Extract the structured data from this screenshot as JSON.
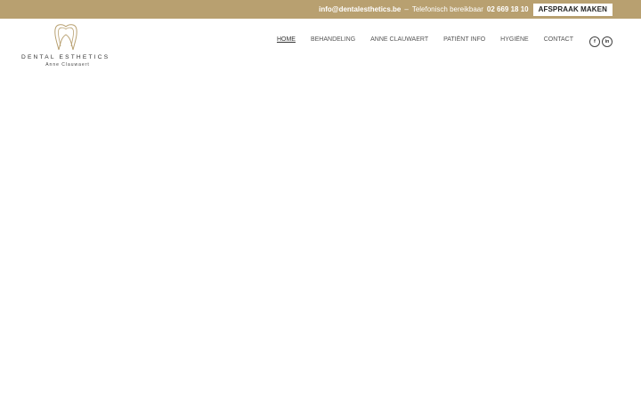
{
  "colors": {
    "accent": "#b8a070"
  },
  "topbar": {
    "email": "info@dentalesthetics.be",
    "separator": "–",
    "phone_label": "Telefonisch bereikbaar",
    "phone_number": "02 669 18 10",
    "cta_label": "AFSPRAAK MAKEN"
  },
  "logo": {
    "brand": "DENTAL ESTHETICS",
    "subtitle": "Anne Clauwaert",
    "icon": "tooth-outline-icon"
  },
  "nav": {
    "items": [
      {
        "label": "HOME",
        "active": true
      },
      {
        "label": "BEHANDELING",
        "active": false
      },
      {
        "label": "ANNE CLAUWAERT",
        "active": false
      },
      {
        "label": "PATIËNT INFO",
        "active": false
      },
      {
        "label": "HYGIËNE",
        "active": false
      },
      {
        "label": "CONTACT",
        "active": false
      }
    ]
  },
  "social": {
    "facebook": {
      "glyph": "f",
      "icon": "facebook-icon"
    },
    "linkedin": {
      "glyph": "in",
      "icon": "linkedin-icon"
    }
  }
}
